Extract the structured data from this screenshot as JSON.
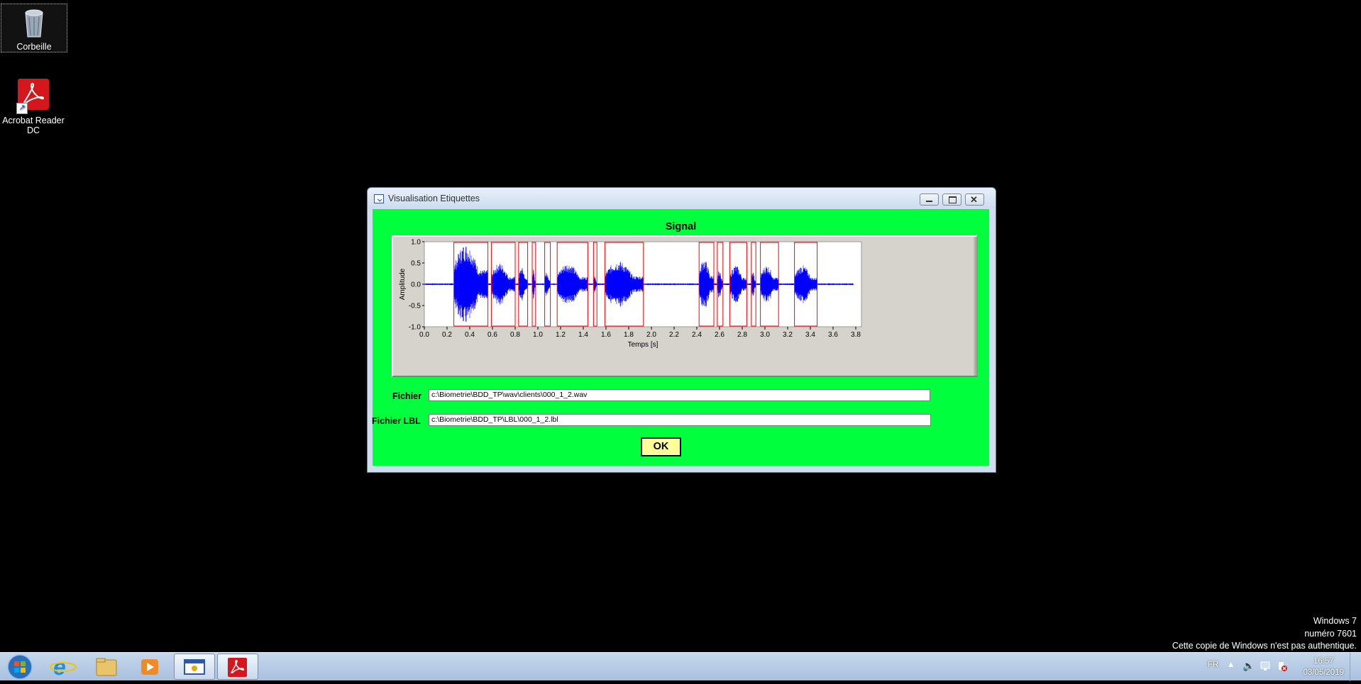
{
  "desktop": {
    "icons": [
      {
        "label": "Corbeille"
      },
      {
        "label": "Acrobat Reader DC"
      }
    ],
    "watermark": [
      "Windows 7",
      "numéro 7601",
      "Cette copie de Windows n'est pas authentique."
    ]
  },
  "window": {
    "title": "Visualisation Etiquettes",
    "graph_title": "Signal",
    "fichier_label": "Fichier",
    "fichier_value": "c:\\Biometrie\\BDD_TP\\wav\\clients\\000_1_2.wav",
    "fichier_lbl_label": "Fichier LBL",
    "fichier_lbl_value": "c:\\Biometrie\\BDD_TP\\LBL\\000_1_2.lbl",
    "ok_label": "OK"
  },
  "chart_data": {
    "type": "line",
    "title": "Signal",
    "xlabel": "Temps [s]",
    "ylabel": "Amplitude",
    "xlim": [
      0.0,
      3.85
    ],
    "ylim": [
      -1.0,
      1.0
    ],
    "xticks": [
      "0.0",
      "0.2",
      "0.4",
      "0.6",
      "0.8",
      "1.0",
      "1.2",
      "1.4",
      "1.6",
      "1.8",
      "2.0",
      "2.2",
      "2.4",
      "2.6",
      "2.8",
      "3.0",
      "3.2",
      "3.4",
      "3.6",
      "3.8"
    ],
    "yticks": [
      "1.0",
      "0.5",
      "0.0",
      "-0.5",
      "-1.0"
    ],
    "series_color": "#0000ff",
    "label_color": "#ff0000",
    "segments": [
      {
        "start": 0.26,
        "end": 0.56,
        "amp": 0.95
      },
      {
        "start": 0.59,
        "end": 0.8,
        "amp": 0.5
      },
      {
        "start": 0.83,
        "end": 0.91,
        "amp": 0.4
      },
      {
        "start": 0.95,
        "end": 0.98,
        "amp": 0.35
      },
      {
        "start": 1.06,
        "end": 1.11,
        "amp": 0.3
      },
      {
        "start": 1.17,
        "end": 1.44,
        "amp": 0.5
      },
      {
        "start": 1.49,
        "end": 1.52,
        "amp": 0.2
      },
      {
        "start": 1.59,
        "end": 1.93,
        "amp": 0.55
      },
      {
        "start": 2.42,
        "end": 2.55,
        "amp": 0.6
      },
      {
        "start": 2.58,
        "end": 2.63,
        "amp": 0.35
      },
      {
        "start": 2.69,
        "end": 2.84,
        "amp": 0.45
      },
      {
        "start": 2.88,
        "end": 2.92,
        "amp": 0.3
      },
      {
        "start": 2.96,
        "end": 3.12,
        "amp": 0.45
      },
      {
        "start": 3.26,
        "end": 3.46,
        "amp": 0.45
      }
    ]
  },
  "taskbar": {
    "items": [
      "start-button",
      "internet-explorer-icon",
      "explorer-folder-icon",
      "media-player-icon",
      "labview-app-icon",
      "acrobat-icon"
    ],
    "language": "FR",
    "time": "16:57",
    "date": "03/05/2019"
  }
}
